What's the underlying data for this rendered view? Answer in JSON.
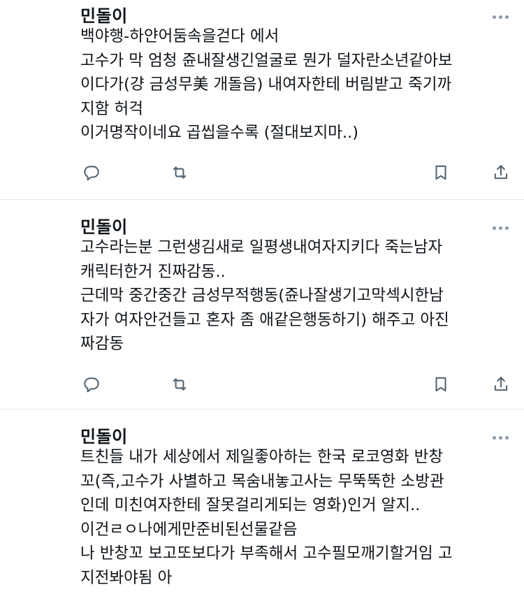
{
  "tweets": [
    {
      "author": "민돌이",
      "lines": [
        "백야행-하얀어둠속을걷다 에서",
        "고수가 막 엄청 쥰내잘생긴얼굴로 뭔가 덜자란소년같아보",
        "이다가(걍 금성무美 개돌음) 내여자한테 버림받고 죽기까",
        "지함 허걱",
        "이거명작이네요 곱씹을수록 (절대보지마..)"
      ]
    },
    {
      "author": "민돌이",
      "lines": [
        "고수라는분 그런생김새로 일평생내여자지키다 죽는남자",
        "캐릭터한거 진짜감동..",
        "근데막 중간중간 금성무적행동(쥰나잘생기고막섹시한남",
        "자가 여자안건들고 혼자 좀 애같은행동하기) 해주고 아진",
        "짜감동"
      ]
    },
    {
      "author": "민돌이",
      "lines": [
        "트친들 내가 세상에서 제일좋아하는 한국 로코영화 반창",
        "꼬(즉,고수가 사별하고 목숨내놓고사는 무뚝뚝한 소방관",
        "인데 미친여자한테 잘못걸리게되는 영화)인거 알지..",
        "이건ㄹㅇ나에게만준비된선물같음",
        "나 반창꼬 보고또보다가 부족해서 고수필모깨기할거임 고",
        "지전봐야됨 아"
      ]
    }
  ],
  "icons": {
    "reply": "reply-icon",
    "retweet": "retweet-icon",
    "bookmark": "bookmark-icon",
    "share": "share-icon",
    "more": "more-icon"
  },
  "colors": {
    "text": "#0f1419",
    "icon": "#536471",
    "divider": "#e1e6ea"
  }
}
